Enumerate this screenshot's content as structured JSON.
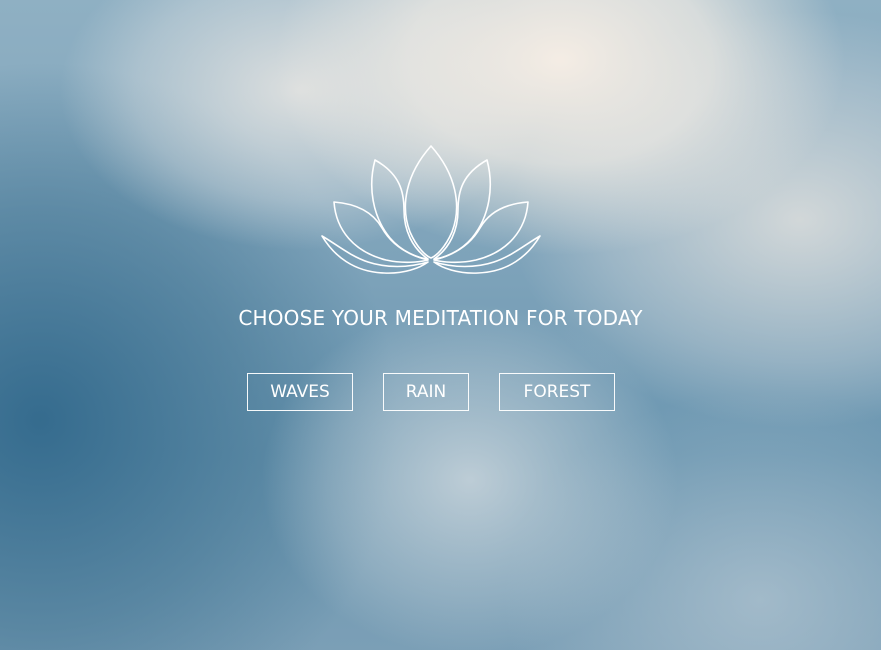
{
  "background": {
    "icon": "cloudy-sky-background"
  },
  "logo": {
    "icon": "lotus-icon",
    "color": "#ffffff"
  },
  "heading": "CHOOSE YOUR MEDITATION FOR TODAY",
  "options": [
    {
      "label": "WAVES"
    },
    {
      "label": "RAIN"
    },
    {
      "label": "FOREST"
    }
  ]
}
